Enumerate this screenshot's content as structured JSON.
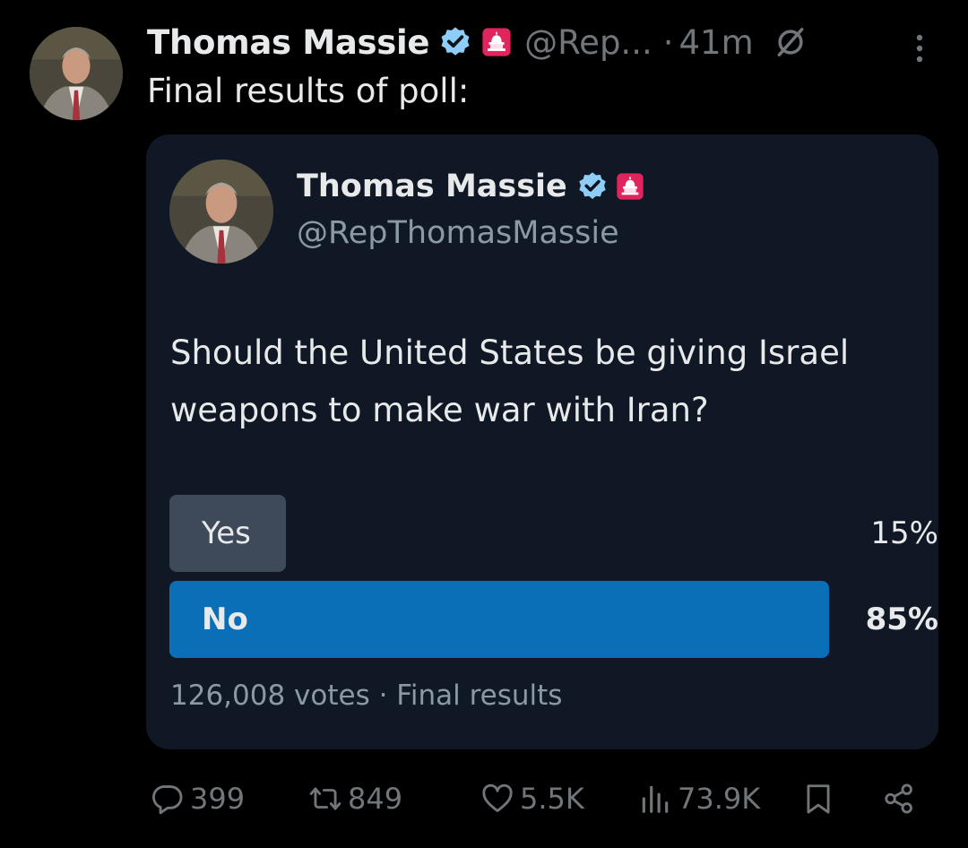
{
  "post": {
    "author_name": "Thomas Massie",
    "handle": "@Rep...",
    "separator": "·",
    "timestamp": "41m",
    "text": "Final results of poll:"
  },
  "quoted_post": {
    "author_name": "Thomas Massie",
    "handle": "@RepThomasMassie",
    "question": "Should the United States be giving Israel weapons to make war with Iran?",
    "poll": {
      "options": [
        {
          "label": "Yes",
          "percent_text": "15%",
          "percent": 15
        },
        {
          "label": "No",
          "percent_text": "85%",
          "percent": 85
        }
      ],
      "summary": "126,008 votes · Final results"
    }
  },
  "actions": {
    "replies": "399",
    "reposts": "849",
    "likes": "5.5K",
    "views": "73.9K"
  },
  "colors": {
    "background": "#000000",
    "card_background": "#0f1824",
    "poll_winner": "#0b6fb8",
    "poll_other": "#3e4a59",
    "verified_blue": "#8ecdf8",
    "gov_badge_red": "#e0245e",
    "muted_text": "#71767b"
  },
  "icons": {
    "verified": "verified-badge-icon",
    "government": "capitol-badge-icon",
    "more": "more-options-icon",
    "null": "null-circle-icon",
    "reply": "reply-icon",
    "repost": "repost-icon",
    "like": "heart-icon",
    "views": "views-chart-icon",
    "bookmark": "bookmark-icon",
    "share": "share-icon"
  }
}
